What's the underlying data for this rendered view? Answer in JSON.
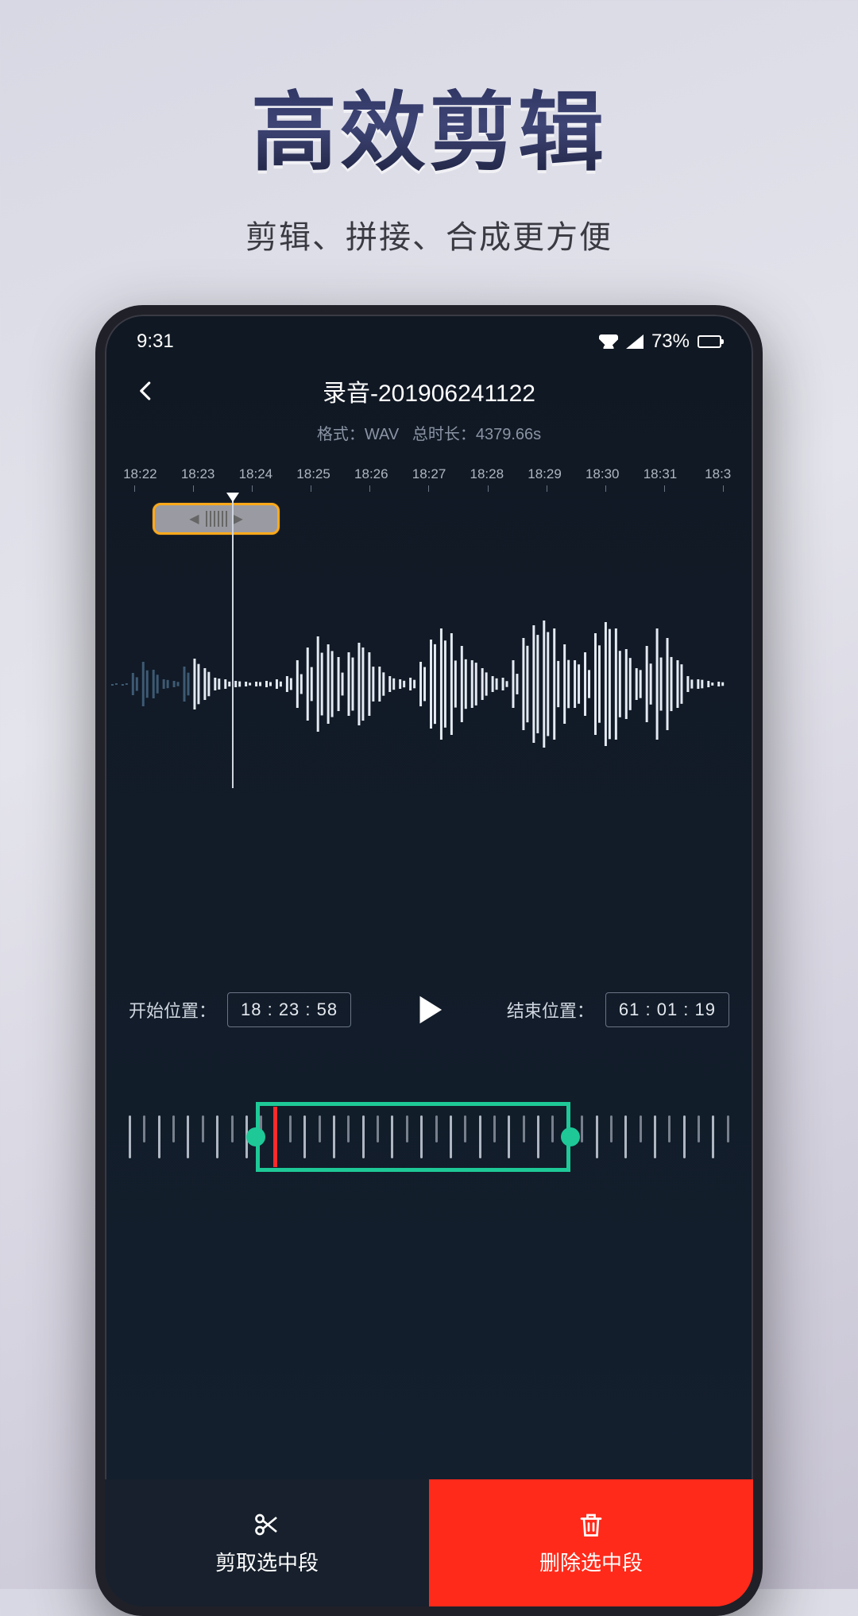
{
  "promo": {
    "title": "高效剪辑",
    "subtitle": "剪辑、拼接、合成更方便"
  },
  "statusbar": {
    "time": "9:31",
    "battery": "73%"
  },
  "header": {
    "title": "录音-201906241122"
  },
  "meta": {
    "format_label": "格式：",
    "format": "WAV",
    "duration_label": "总时长：",
    "duration": "4379.66s"
  },
  "timeline": {
    "ticks": [
      "18:22",
      "18:23",
      "18:24",
      "18:25",
      "18:26",
      "18:27",
      "18:28",
      "18:29",
      "18:30",
      "18:31",
      "18:3"
    ]
  },
  "controls": {
    "start_label": "开始位置：",
    "start_value": "18 : 23 : 58",
    "end_label": "结束位置：",
    "end_value": "61 : 01 : 19"
  },
  "bottombar": {
    "trim": "剪取选中段",
    "delete": "删除选中段"
  },
  "colors": {
    "accent_green": "#1ec997",
    "accent_orange": "#ffa91a",
    "danger": "#ff2a1a"
  }
}
